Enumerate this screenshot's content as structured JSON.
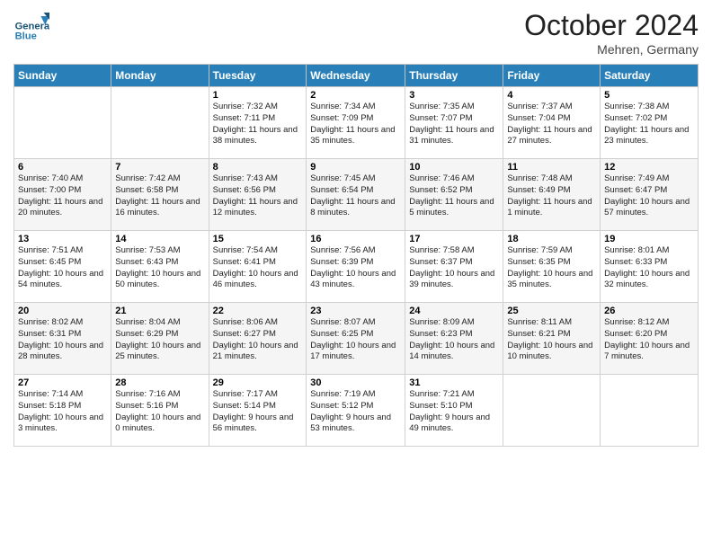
{
  "logo": {
    "general": "General",
    "blue": "Blue"
  },
  "header": {
    "month": "October 2024",
    "location": "Mehren, Germany"
  },
  "days_of_week": [
    "Sunday",
    "Monday",
    "Tuesday",
    "Wednesday",
    "Thursday",
    "Friday",
    "Saturday"
  ],
  "weeks": [
    [
      {
        "day": "",
        "sunrise": "",
        "sunset": "",
        "daylight": ""
      },
      {
        "day": "",
        "sunrise": "",
        "sunset": "",
        "daylight": ""
      },
      {
        "day": "1",
        "sunrise": "Sunrise: 7:32 AM",
        "sunset": "Sunset: 7:11 PM",
        "daylight": "Daylight: 11 hours and 38 minutes."
      },
      {
        "day": "2",
        "sunrise": "Sunrise: 7:34 AM",
        "sunset": "Sunset: 7:09 PM",
        "daylight": "Daylight: 11 hours and 35 minutes."
      },
      {
        "day": "3",
        "sunrise": "Sunrise: 7:35 AM",
        "sunset": "Sunset: 7:07 PM",
        "daylight": "Daylight: 11 hours and 31 minutes."
      },
      {
        "day": "4",
        "sunrise": "Sunrise: 7:37 AM",
        "sunset": "Sunset: 7:04 PM",
        "daylight": "Daylight: 11 hours and 27 minutes."
      },
      {
        "day": "5",
        "sunrise": "Sunrise: 7:38 AM",
        "sunset": "Sunset: 7:02 PM",
        "daylight": "Daylight: 11 hours and 23 minutes."
      }
    ],
    [
      {
        "day": "6",
        "sunrise": "Sunrise: 7:40 AM",
        "sunset": "Sunset: 7:00 PM",
        "daylight": "Daylight: 11 hours and 20 minutes."
      },
      {
        "day": "7",
        "sunrise": "Sunrise: 7:42 AM",
        "sunset": "Sunset: 6:58 PM",
        "daylight": "Daylight: 11 hours and 16 minutes."
      },
      {
        "day": "8",
        "sunrise": "Sunrise: 7:43 AM",
        "sunset": "Sunset: 6:56 PM",
        "daylight": "Daylight: 11 hours and 12 minutes."
      },
      {
        "day": "9",
        "sunrise": "Sunrise: 7:45 AM",
        "sunset": "Sunset: 6:54 PM",
        "daylight": "Daylight: 11 hours and 8 minutes."
      },
      {
        "day": "10",
        "sunrise": "Sunrise: 7:46 AM",
        "sunset": "Sunset: 6:52 PM",
        "daylight": "Daylight: 11 hours and 5 minutes."
      },
      {
        "day": "11",
        "sunrise": "Sunrise: 7:48 AM",
        "sunset": "Sunset: 6:49 PM",
        "daylight": "Daylight: 11 hours and 1 minute."
      },
      {
        "day": "12",
        "sunrise": "Sunrise: 7:49 AM",
        "sunset": "Sunset: 6:47 PM",
        "daylight": "Daylight: 10 hours and 57 minutes."
      }
    ],
    [
      {
        "day": "13",
        "sunrise": "Sunrise: 7:51 AM",
        "sunset": "Sunset: 6:45 PM",
        "daylight": "Daylight: 10 hours and 54 minutes."
      },
      {
        "day": "14",
        "sunrise": "Sunrise: 7:53 AM",
        "sunset": "Sunset: 6:43 PM",
        "daylight": "Daylight: 10 hours and 50 minutes."
      },
      {
        "day": "15",
        "sunrise": "Sunrise: 7:54 AM",
        "sunset": "Sunset: 6:41 PM",
        "daylight": "Daylight: 10 hours and 46 minutes."
      },
      {
        "day": "16",
        "sunrise": "Sunrise: 7:56 AM",
        "sunset": "Sunset: 6:39 PM",
        "daylight": "Daylight: 10 hours and 43 minutes."
      },
      {
        "day": "17",
        "sunrise": "Sunrise: 7:58 AM",
        "sunset": "Sunset: 6:37 PM",
        "daylight": "Daylight: 10 hours and 39 minutes."
      },
      {
        "day": "18",
        "sunrise": "Sunrise: 7:59 AM",
        "sunset": "Sunset: 6:35 PM",
        "daylight": "Daylight: 10 hours and 35 minutes."
      },
      {
        "day": "19",
        "sunrise": "Sunrise: 8:01 AM",
        "sunset": "Sunset: 6:33 PM",
        "daylight": "Daylight: 10 hours and 32 minutes."
      }
    ],
    [
      {
        "day": "20",
        "sunrise": "Sunrise: 8:02 AM",
        "sunset": "Sunset: 6:31 PM",
        "daylight": "Daylight: 10 hours and 28 minutes."
      },
      {
        "day": "21",
        "sunrise": "Sunrise: 8:04 AM",
        "sunset": "Sunset: 6:29 PM",
        "daylight": "Daylight: 10 hours and 25 minutes."
      },
      {
        "day": "22",
        "sunrise": "Sunrise: 8:06 AM",
        "sunset": "Sunset: 6:27 PM",
        "daylight": "Daylight: 10 hours and 21 minutes."
      },
      {
        "day": "23",
        "sunrise": "Sunrise: 8:07 AM",
        "sunset": "Sunset: 6:25 PM",
        "daylight": "Daylight: 10 hours and 17 minutes."
      },
      {
        "day": "24",
        "sunrise": "Sunrise: 8:09 AM",
        "sunset": "Sunset: 6:23 PM",
        "daylight": "Daylight: 10 hours and 14 minutes."
      },
      {
        "day": "25",
        "sunrise": "Sunrise: 8:11 AM",
        "sunset": "Sunset: 6:21 PM",
        "daylight": "Daylight: 10 hours and 10 minutes."
      },
      {
        "day": "26",
        "sunrise": "Sunrise: 8:12 AM",
        "sunset": "Sunset: 6:20 PM",
        "daylight": "Daylight: 10 hours and 7 minutes."
      }
    ],
    [
      {
        "day": "27",
        "sunrise": "Sunrise: 7:14 AM",
        "sunset": "Sunset: 5:18 PM",
        "daylight": "Daylight: 10 hours and 3 minutes."
      },
      {
        "day": "28",
        "sunrise": "Sunrise: 7:16 AM",
        "sunset": "Sunset: 5:16 PM",
        "daylight": "Daylight: 10 hours and 0 minutes."
      },
      {
        "day": "29",
        "sunrise": "Sunrise: 7:17 AM",
        "sunset": "Sunset: 5:14 PM",
        "daylight": "Daylight: 9 hours and 56 minutes."
      },
      {
        "day": "30",
        "sunrise": "Sunrise: 7:19 AM",
        "sunset": "Sunset: 5:12 PM",
        "daylight": "Daylight: 9 hours and 53 minutes."
      },
      {
        "day": "31",
        "sunrise": "Sunrise: 7:21 AM",
        "sunset": "Sunset: 5:10 PM",
        "daylight": "Daylight: 9 hours and 49 minutes."
      },
      {
        "day": "",
        "sunrise": "",
        "sunset": "",
        "daylight": ""
      },
      {
        "day": "",
        "sunrise": "",
        "sunset": "",
        "daylight": ""
      }
    ]
  ]
}
